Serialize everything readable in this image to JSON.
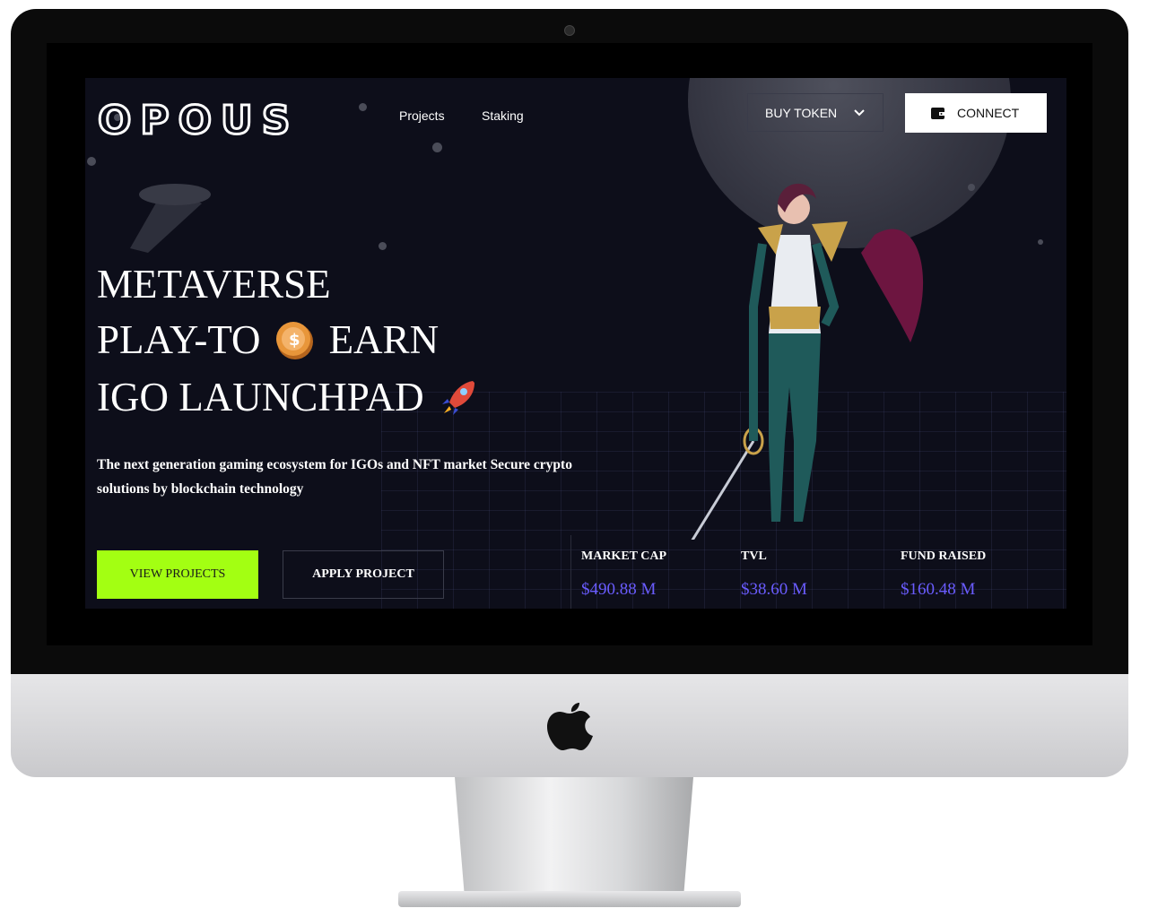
{
  "brand": {
    "logo_text": "OPOUS"
  },
  "nav": {
    "projects": "Projects",
    "staking": "Staking"
  },
  "header": {
    "buy_token_label": "BUY TOKEN",
    "connect_label": "CONNECT",
    "wallet_icon": "wallet-icon",
    "chevron_icon": "chevron-down-icon"
  },
  "hero": {
    "line1": "METAVERSE",
    "line2_a": "PLAY-TO",
    "line2_b": "EARN",
    "line3": "IGO LAUNCHPAD",
    "coin_icon": "coin-icon",
    "rocket_icon": "rocket-icon",
    "subtitle": "The next generation gaming ecosystem for IGOs and NFT market Secure crypto solutions by blockchain technology"
  },
  "actions": {
    "view_projects": "VIEW PROJECTS",
    "apply_project": "APPLY PROJECT"
  },
  "stats": [
    {
      "label": "MARKET CAP",
      "value": "$490.88 M"
    },
    {
      "label": "TVL",
      "value": "$38.60 M"
    },
    {
      "label": "FUND RAISED",
      "value": "$160.48 M"
    }
  ],
  "colors": {
    "accent": "#a3ff12",
    "stat_value": "#6a5cff",
    "background": "#0d0e1a"
  }
}
